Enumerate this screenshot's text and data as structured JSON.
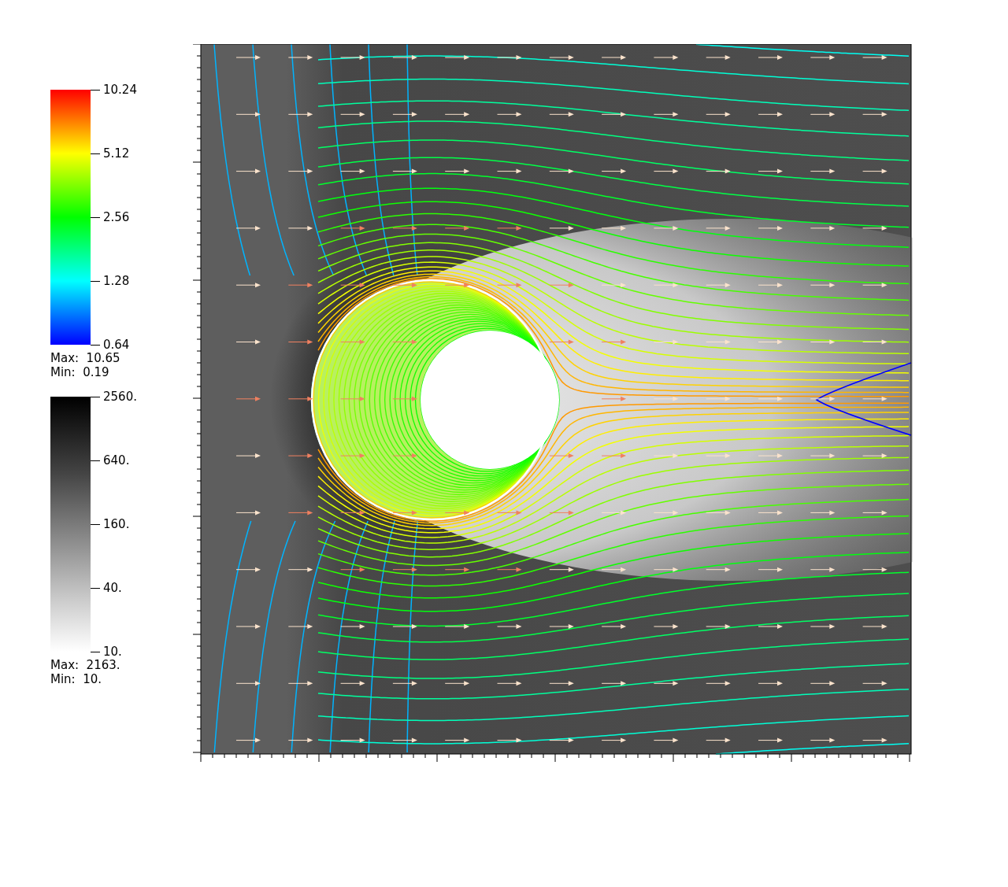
{
  "legends": [
    {
      "kind": "rainbow",
      "ticks": [
        "10.24",
        "5.12",
        "2.56",
        "1.28",
        "0.64"
      ],
      "max": "Max:  10.65",
      "min": "Min:  0.19"
    },
    {
      "kind": "grayscale",
      "ticks": [
        "2560.",
        "640.",
        "160.",
        "40.",
        "10."
      ],
      "max": "Max:  2163.",
      "min": "Min:  10."
    }
  ]
}
